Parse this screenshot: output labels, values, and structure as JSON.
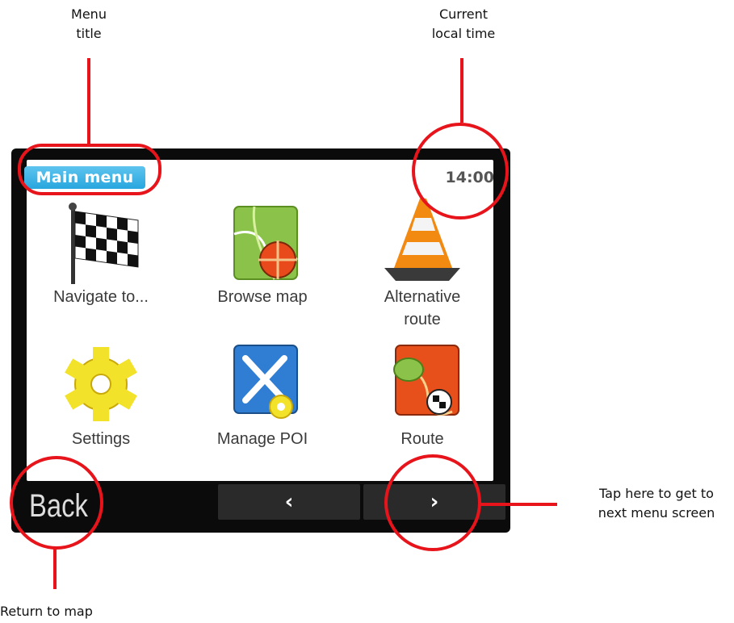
{
  "annotations": {
    "menu_title": "Menu\ntitle",
    "current_time": "Current\nlocal time",
    "next_screen": "Tap here to get to\nnext menu screen",
    "return_map": "Return to map"
  },
  "screen": {
    "title": "Main menu",
    "time": "14:00",
    "items": [
      {
        "label": "Navigate to...",
        "icon": "checkered-flag-icon"
      },
      {
        "label": "Browse map",
        "icon": "map-icon"
      },
      {
        "label": "Alternative\nroute",
        "icon": "traffic-cone-icon"
      },
      {
        "label": "Settings",
        "icon": "gear-icon"
      },
      {
        "label": "Manage POI",
        "icon": "fork-knife-icon"
      },
      {
        "label": "Route",
        "icon": "route-map-icon"
      }
    ],
    "back_label": "Back",
    "prev_symbol": "‹",
    "next_symbol": "›"
  },
  "colors": {
    "title_tag": "#27a6de",
    "annotation": "#e8141b",
    "device": "#0b0b0b"
  }
}
